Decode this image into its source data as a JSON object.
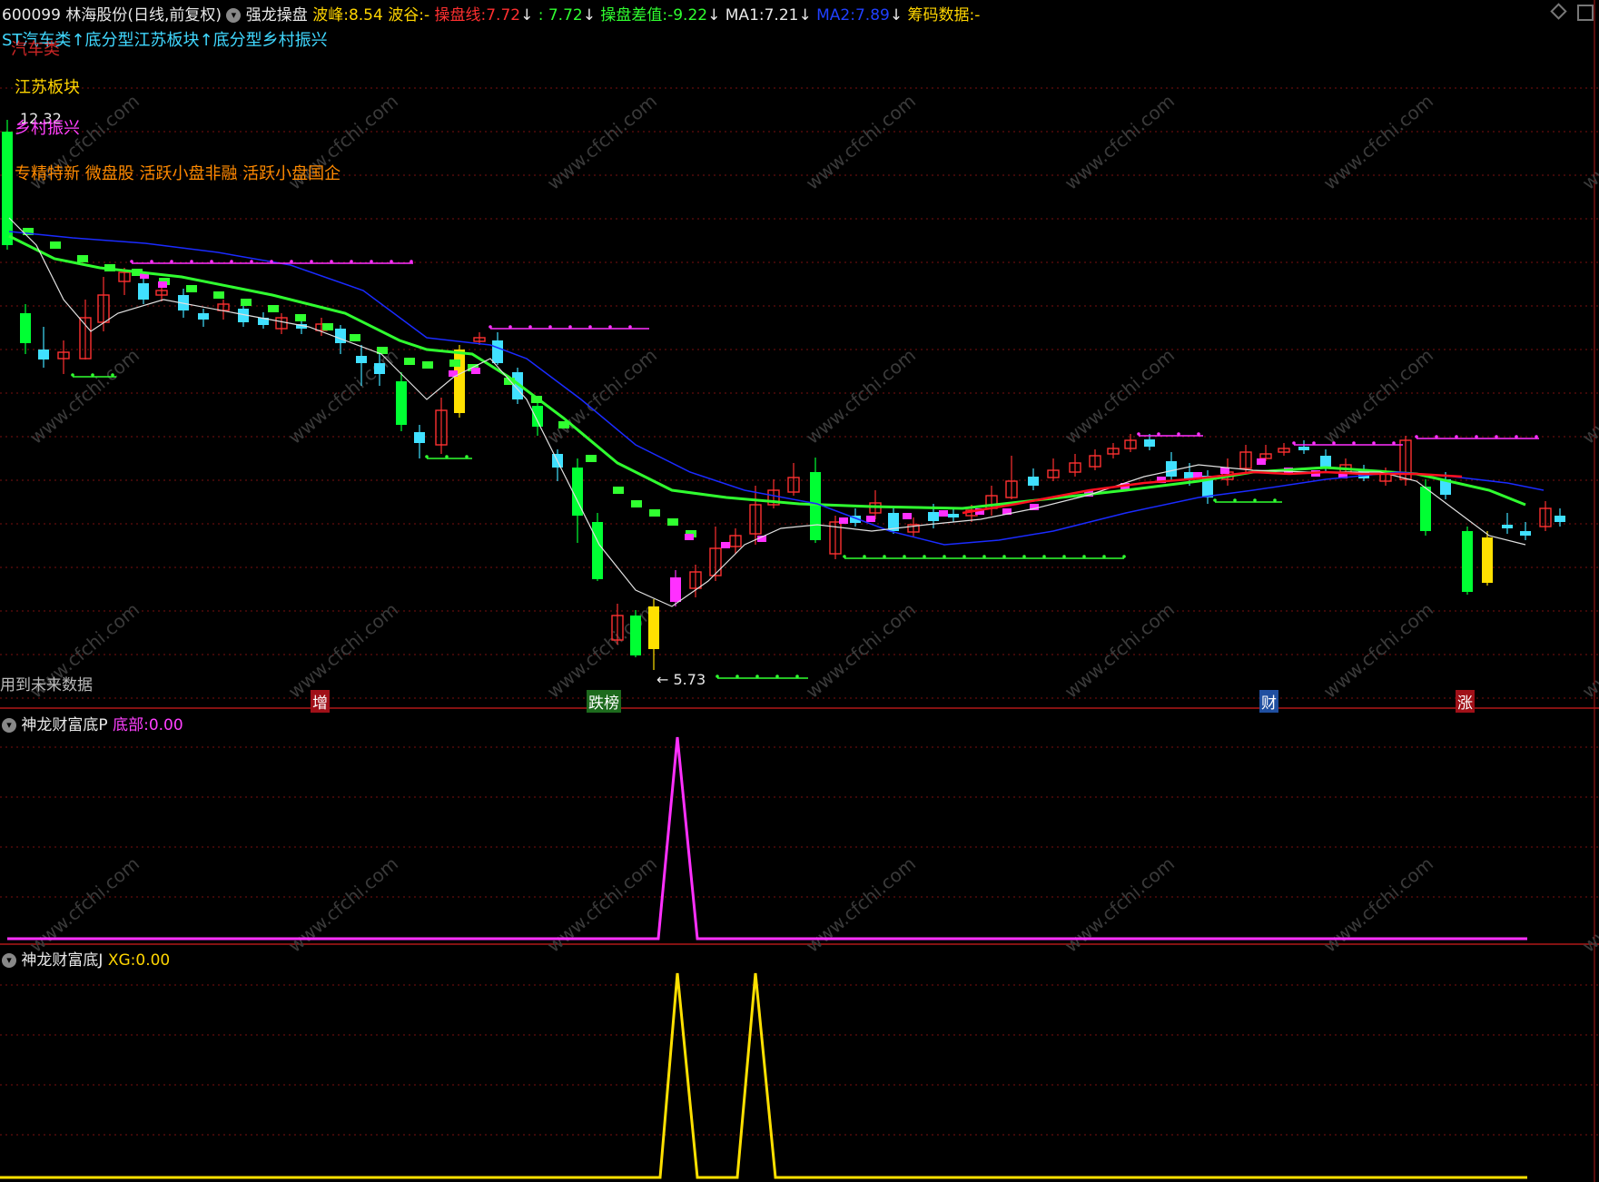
{
  "header": {
    "stock_code": "600099",
    "stock_name": "林海股份",
    "period": "(日线,前复权)",
    "indicator": "强龙操盘",
    "peak_label": "波峰:",
    "peak_value": "8.54",
    "trough_label": "波谷:",
    "trough_value": "-",
    "line_label": "操盘线:",
    "line_value": "7.72",
    "line_arrow": "↓",
    "colon_value": ": 7.72",
    "colon_arrow": "↓",
    "diff_label": "操盘差值:",
    "diff_value": "-9.22",
    "diff_arrow": "↓",
    "ma1_label": "MA1:",
    "ma1_value": "7.21",
    "ma1_arrow": "↓",
    "ma2_label": "MA2:",
    "ma2_value": "7.89",
    "ma2_arrow": "↓",
    "chip_label": "筹码数据:",
    "chip_value": "-"
  },
  "overlay": {
    "concept_line": "ST汽车类↑底分型江苏板块↑底分型乡村振兴",
    "car_label": "汽车类",
    "region": "江苏板块",
    "high_mark": "12.32",
    "rural": "乡村振兴",
    "tags": "专精特新 微盘股 活跃小盘非融 活跃小盘国企",
    "future_data": "用到未来数据",
    "low_mark": "← 5.73"
  },
  "markers": [
    "增",
    "跌榜",
    "财",
    "涨"
  ],
  "panel_p": {
    "title": "神龙财富底P",
    "label": "底部:",
    "value": "0.00"
  },
  "panel_j": {
    "title": "神龙财富底J",
    "label": "XG:",
    "value": "0.00"
  },
  "watermark": "www.cfchi.com",
  "colors": {
    "up": "#ff3030",
    "down_green": "#00ff33",
    "down_cyan": "#40e0ff",
    "signal_yellow": "#ffe000",
    "signal_magenta": "#ff30ff",
    "ma_green": "#30ff30",
    "ma_blue": "#1a2bff",
    "ma_white": "#e0e0e0",
    "ma_red": "#ff1020"
  }
}
